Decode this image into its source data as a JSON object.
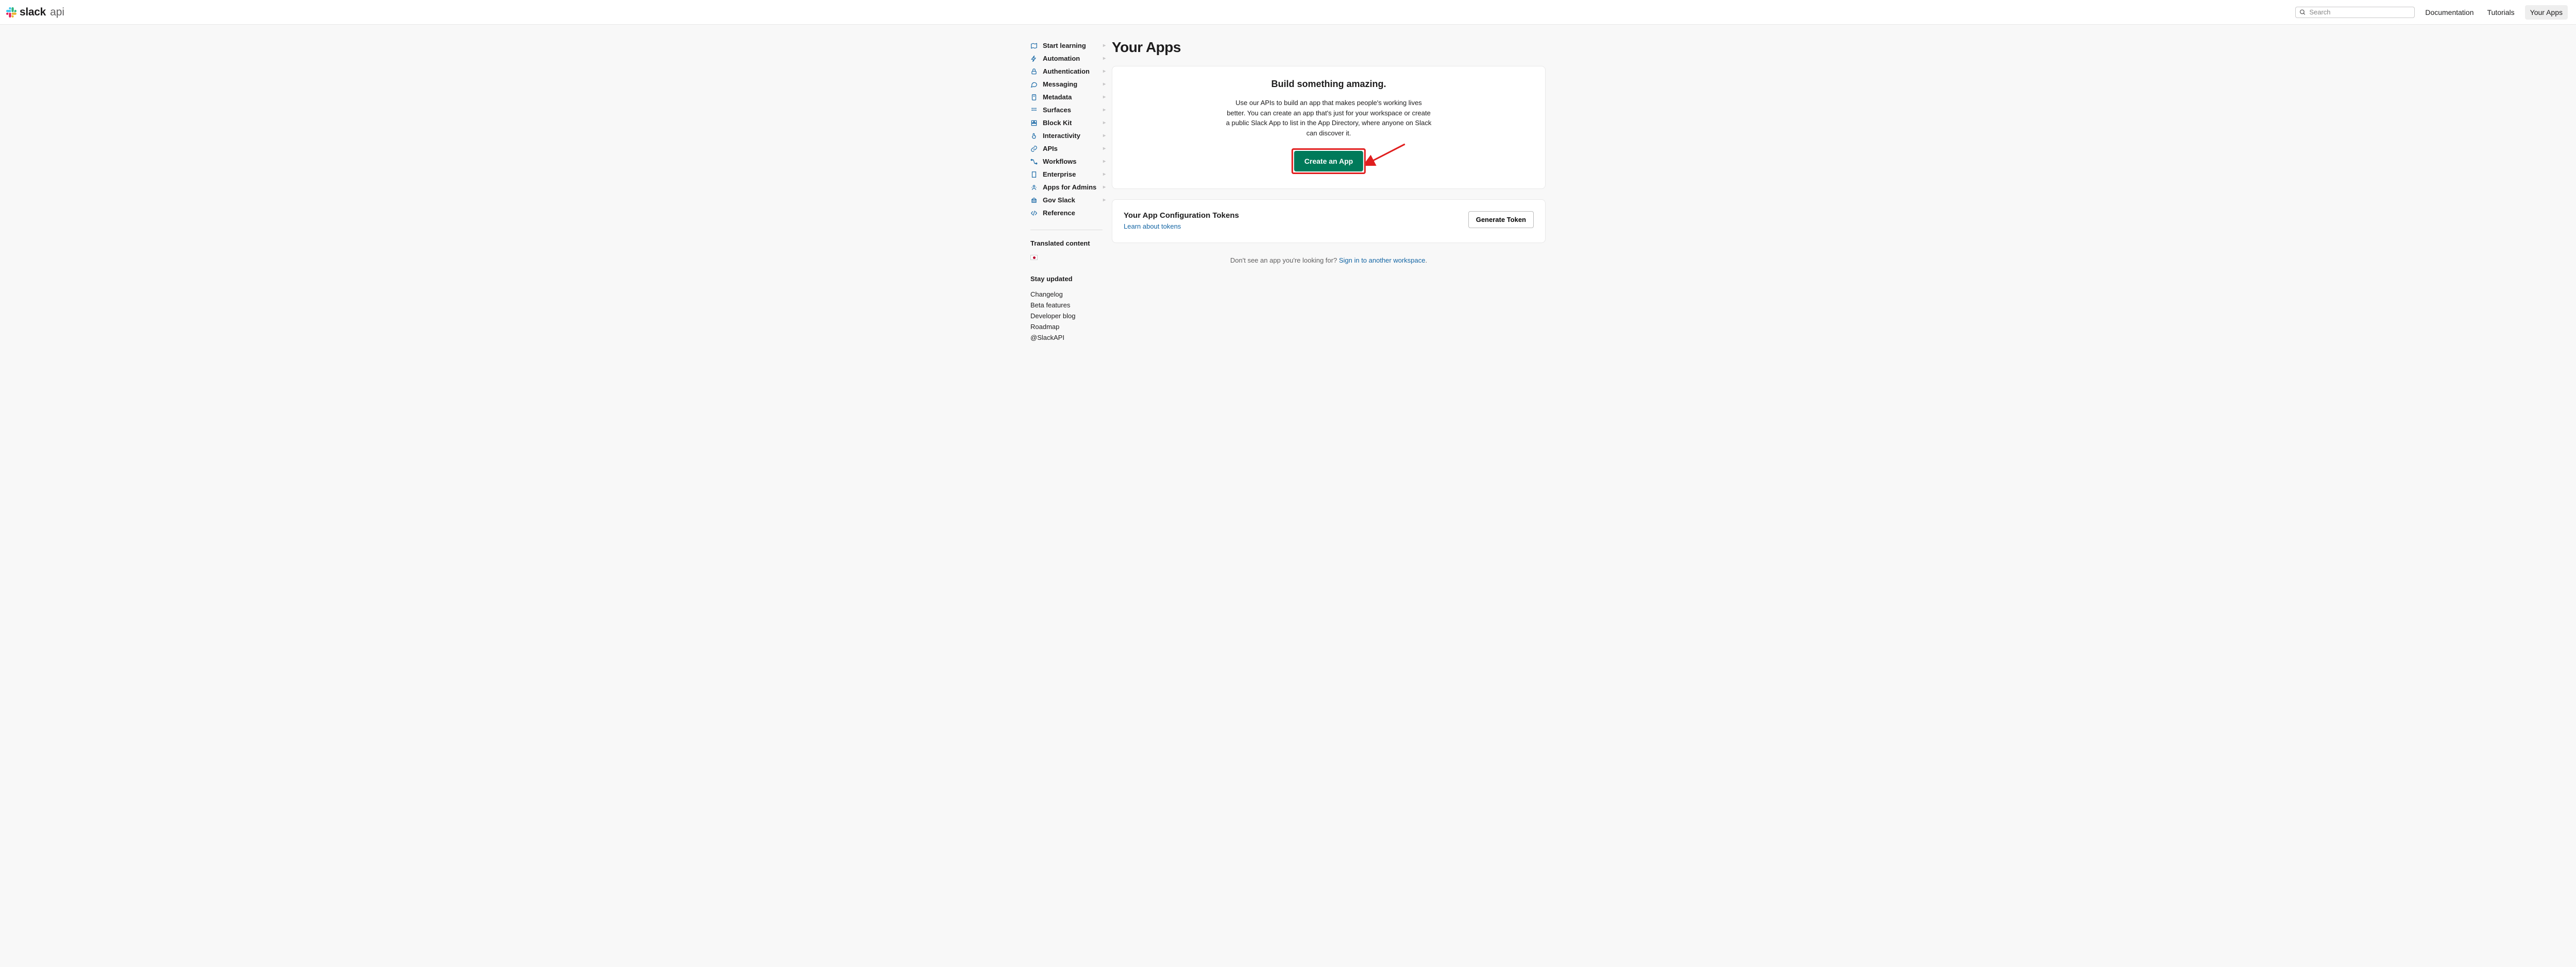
{
  "header": {
    "logo_bold": "slack",
    "logo_light": "api",
    "search_placeholder": "Search",
    "nav": {
      "docs": "Documentation",
      "tutorials": "Tutorials",
      "your_apps": "Your Apps"
    }
  },
  "sidebar": {
    "items": [
      {
        "label": "Start learning",
        "icon": "map"
      },
      {
        "label": "Automation",
        "icon": "bolt"
      },
      {
        "label": "Authentication",
        "icon": "lock"
      },
      {
        "label": "Messaging",
        "icon": "chat"
      },
      {
        "label": "Metadata",
        "icon": "doc"
      },
      {
        "label": "Surfaces",
        "icon": "grid"
      },
      {
        "label": "Block Kit",
        "icon": "blocks"
      },
      {
        "label": "Interactivity",
        "icon": "tap"
      },
      {
        "label": "APIs",
        "icon": "link"
      },
      {
        "label": "Workflows",
        "icon": "flow"
      },
      {
        "label": "Enterprise",
        "icon": "building"
      },
      {
        "label": "Apps for Admins",
        "icon": "admin"
      },
      {
        "label": "Gov Slack",
        "icon": "gov"
      },
      {
        "label": "Reference",
        "icon": "code",
        "no_chev": true
      }
    ],
    "translated_heading": "Translated content",
    "stay_updated_heading": "Stay updated",
    "footer_links": [
      "Changelog",
      "Beta features",
      "Developer blog",
      "Roadmap",
      "@SlackAPI"
    ]
  },
  "main": {
    "title": "Your Apps",
    "hero_title": "Build something amazing.",
    "hero_desc": "Use our APIs to build an app that makes people's working lives better. You can create an app that's just for your workspace or create a public Slack App to list in the App Directory, where anyone on Slack can discover it.",
    "cta": "Create an App",
    "tokens_title": "Your App Configuration Tokens",
    "tokens_link": "Learn about tokens",
    "generate_btn": "Generate Token",
    "signin_prefix": "Don't see an app you're looking for? ",
    "signin_link": "Sign in to another workspace",
    "signin_suffix": "."
  }
}
